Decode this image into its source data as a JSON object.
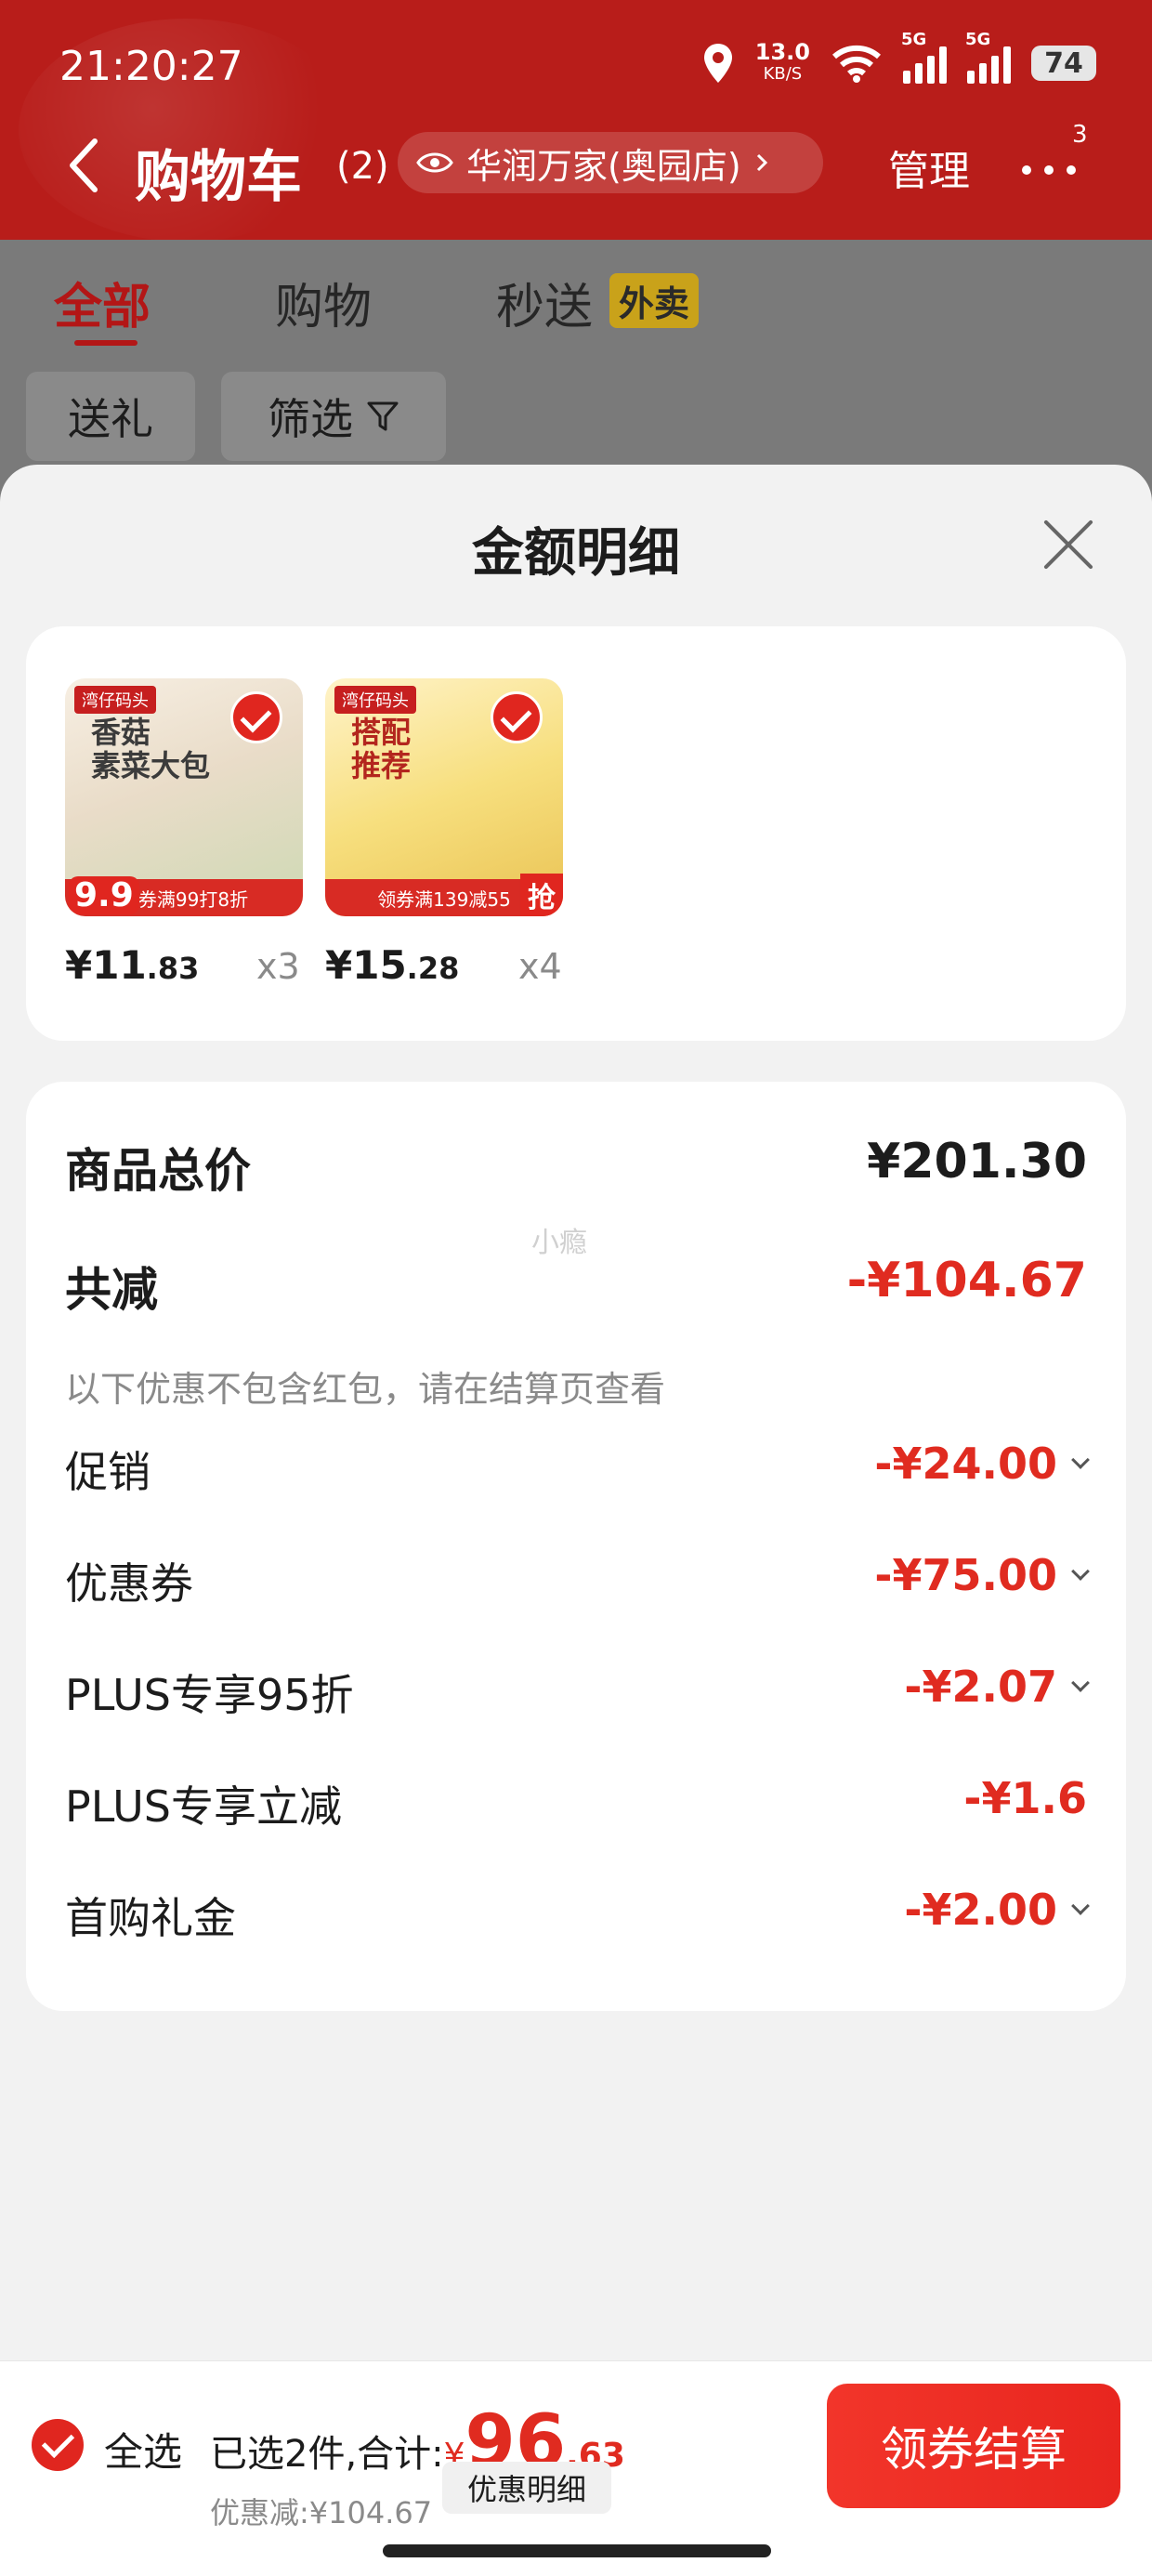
{
  "status_bar": {
    "time": "21:20:27",
    "speed": "13.0",
    "speed_unit": "KB/S",
    "net1": "5G",
    "net2": "5G",
    "battery": "74"
  },
  "header": {
    "title": "购物车",
    "count": "(2)",
    "store": "华润万家(奥园店)",
    "manage": "管理",
    "more_badge": "3"
  },
  "tabs": [
    {
      "label": "全部"
    },
    {
      "label": "购物"
    },
    {
      "label": "秒送"
    }
  ],
  "tab_badge": "外卖",
  "chips": [
    {
      "label": "送礼"
    },
    {
      "label": "筛选"
    }
  ],
  "sheet": {
    "title": "金额明细",
    "products": [
      {
        "price_int": "¥11",
        "price_dec": ".83",
        "qty": "x3",
        "img_text": "香菇\n素菜大包",
        "img_tag": "湾仔码头",
        "img_banner": "领券满99打8折",
        "img_badge": "9.9"
      },
      {
        "price_int": "¥15",
        "price_dec": ".28",
        "qty": "x4",
        "img_text": "搭配\n推荐",
        "img_tag": "湾仔码头",
        "img_banner": "领券满139减55",
        "img_badge": "抢"
      }
    ],
    "watermark": "小瘾",
    "summary": {
      "total_label": "商品总价",
      "total_value": "¥201.30",
      "reduce_label": "共减",
      "reduce_value": "-¥104.67",
      "note": "以下优惠不包含红包，请在结算页查看",
      "items": [
        {
          "label": "促销",
          "value": "-¥24.00",
          "expand": true
        },
        {
          "label": "优惠券",
          "value": "-¥75.00",
          "expand": true
        },
        {
          "label": "PLUS专享95折",
          "value": "-¥2.07",
          "expand": true
        },
        {
          "label": "PLUS专享立减",
          "value": "-¥1.6",
          "expand": false
        },
        {
          "label": "首购礼金",
          "value": "-¥2.00",
          "expand": true
        }
      ]
    }
  },
  "bottom": {
    "select_all": "全选",
    "selected_text": "已选2件,合计:",
    "yen": "¥",
    "total_int": "96",
    "total_dec": ".63",
    "discount_text": "优惠减:¥104.67",
    "discount_button": "优惠明细",
    "checkout": "领券结算"
  },
  "colors": {
    "brand_red": "#e0261f",
    "header_red": "#b81d1a"
  }
}
